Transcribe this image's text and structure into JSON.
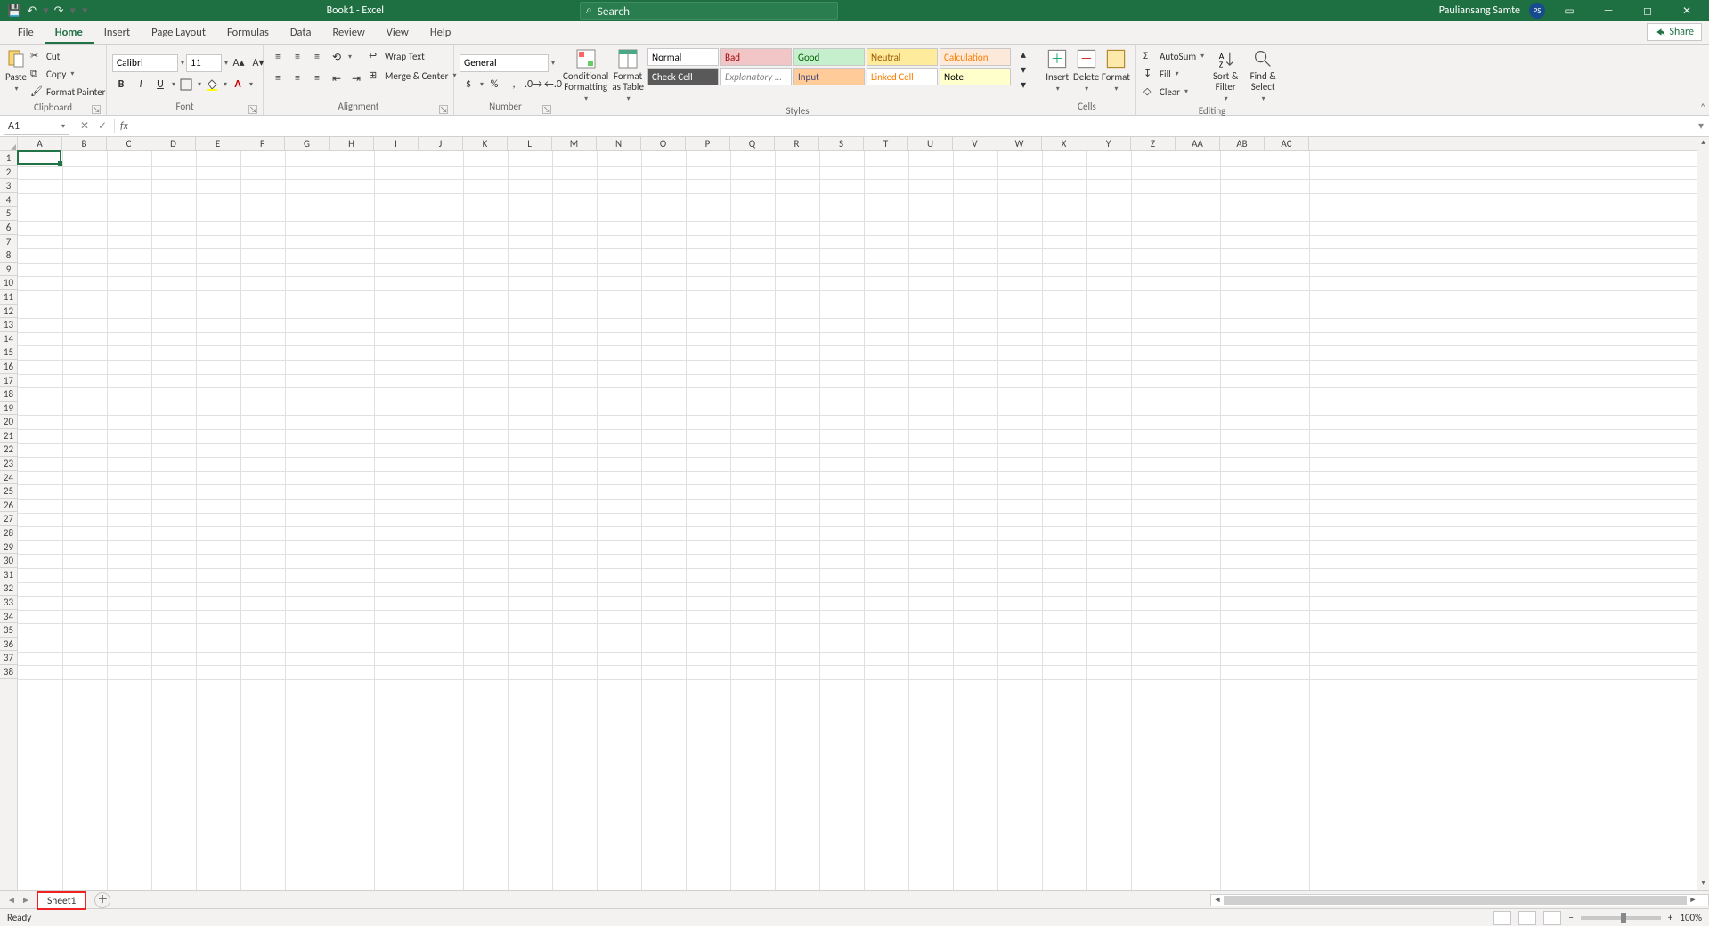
{
  "title": "Book1 - Excel",
  "search_placeholder": "Search",
  "user_name": "Pauliansang Samte",
  "user_initials": "PS",
  "tabs": [
    "File",
    "Home",
    "Insert",
    "Page Layout",
    "Formulas",
    "Data",
    "Review",
    "View",
    "Help"
  ],
  "active_tab": "Home",
  "share_label": "Share",
  "clipboard": {
    "paste": "Paste",
    "cut": "Cut",
    "copy": "Copy",
    "painter": "Format Painter",
    "label": "Clipboard"
  },
  "font": {
    "name": "Calibri",
    "size": "11",
    "bold": "B",
    "italic": "I",
    "underline": "U",
    "label": "Font"
  },
  "alignment": {
    "wrap": "Wrap Text",
    "merge": "Merge & Center",
    "label": "Alignment"
  },
  "number": {
    "format": "General",
    "label": "Number"
  },
  "styles": {
    "cond": "Conditional Formatting",
    "fat": "Format as Table",
    "cells": [
      {
        "t": "Normal",
        "bg": "#ffffff",
        "c": "#000"
      },
      {
        "t": "Bad",
        "bg": "#f2c6c6",
        "c": "#9c0006"
      },
      {
        "t": "Good",
        "bg": "#c6efce",
        "c": "#006100"
      },
      {
        "t": "Neutral",
        "bg": "#ffeb9c",
        "c": "#9c5700"
      },
      {
        "t": "Calculation",
        "bg": "#fde9d9",
        "c": "#fa7d00"
      },
      {
        "t": "Check Cell",
        "bg": "#595959",
        "c": "#ffffff"
      },
      {
        "t": "Explanatory ...",
        "bg": "#ffffff",
        "c": "#7f7f7f",
        "i": true
      },
      {
        "t": "Input",
        "bg": "#ffcc99",
        "c": "#3f3f76"
      },
      {
        "t": "Linked Cell",
        "bg": "#ffffff",
        "c": "#fa7d00"
      },
      {
        "t": "Note",
        "bg": "#ffffcc",
        "c": "#000"
      }
    ],
    "label": "Styles"
  },
  "cells_group": {
    "insert": "Insert",
    "delete": "Delete",
    "format": "Format",
    "label": "Cells"
  },
  "editing": {
    "autosum": "AutoSum",
    "fill": "Fill",
    "clear": "Clear",
    "sort": "Sort & Filter",
    "find": "Find & Select",
    "label": "Editing"
  },
  "namebox": "A1",
  "columns": [
    "A",
    "B",
    "C",
    "D",
    "E",
    "F",
    "G",
    "H",
    "I",
    "J",
    "K",
    "L",
    "M",
    "N",
    "O",
    "P",
    "Q",
    "R",
    "S",
    "T",
    "U",
    "V",
    "W",
    "X",
    "Y",
    "Z",
    "AA",
    "AB",
    "AC"
  ],
  "row_count": 38,
  "selection": {
    "col": 0,
    "row": 0
  },
  "sheet_tab": "Sheet1",
  "status": "Ready",
  "zoom": "100%"
}
